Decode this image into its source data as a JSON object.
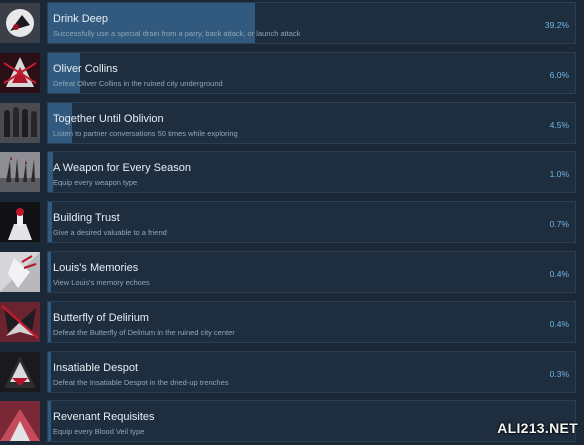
{
  "achievements": [
    {
      "name": "Drink Deep",
      "description": "Successfully use a special drain from a parry, back attack, or launch attack",
      "percent_label": "39.2%",
      "percent": 39.2,
      "icon": "drink-deep-icon"
    },
    {
      "name": "Oliver Collins",
      "description": "Defeat Oliver Collins in the ruined city underground",
      "percent_label": "6.0%",
      "percent": 6.0,
      "icon": "oliver-collins-icon"
    },
    {
      "name": "Together Until Oblivion",
      "description": "Listen to partner conversations 50 times while exploring",
      "percent_label": "4.5%",
      "percent": 4.5,
      "icon": "together-until-oblivion-icon"
    },
    {
      "name": "A Weapon for Every Season",
      "description": "Equip every weapon type",
      "percent_label": "1.0%",
      "percent": 1.0,
      "icon": "weapon-every-season-icon"
    },
    {
      "name": "Building Trust",
      "description": "Give a desired valuable to a friend",
      "percent_label": "0.7%",
      "percent": 0.7,
      "icon": "building-trust-icon"
    },
    {
      "name": "Louis's Memories",
      "description": "View Louis's memory echoes",
      "percent_label": "0.4%",
      "percent": 0.4,
      "icon": "louis-memories-icon"
    },
    {
      "name": "Butterfly of Delirium",
      "description": "Defeat the Butterfly of Delirium in the ruined city center",
      "percent_label": "0.4%",
      "percent": 0.4,
      "icon": "butterfly-of-delirium-icon"
    },
    {
      "name": "Insatiable Despot",
      "description": "Defeat the Insatiable Despot in the dried-up trenches",
      "percent_label": "0.3%",
      "percent": 0.3,
      "icon": "insatiable-despot-icon"
    },
    {
      "name": "Revenant Requisites",
      "description": "Equip every Blood Veil type",
      "percent_label": "",
      "percent": 0.3,
      "icon": "revenant-requisites-icon"
    }
  ],
  "watermark": "ALI213.NET",
  "colors": {
    "background": "#1b2838",
    "panel": "#1f2e3f",
    "progress": "#35628a",
    "percent_text": "#6fb6e8"
  }
}
